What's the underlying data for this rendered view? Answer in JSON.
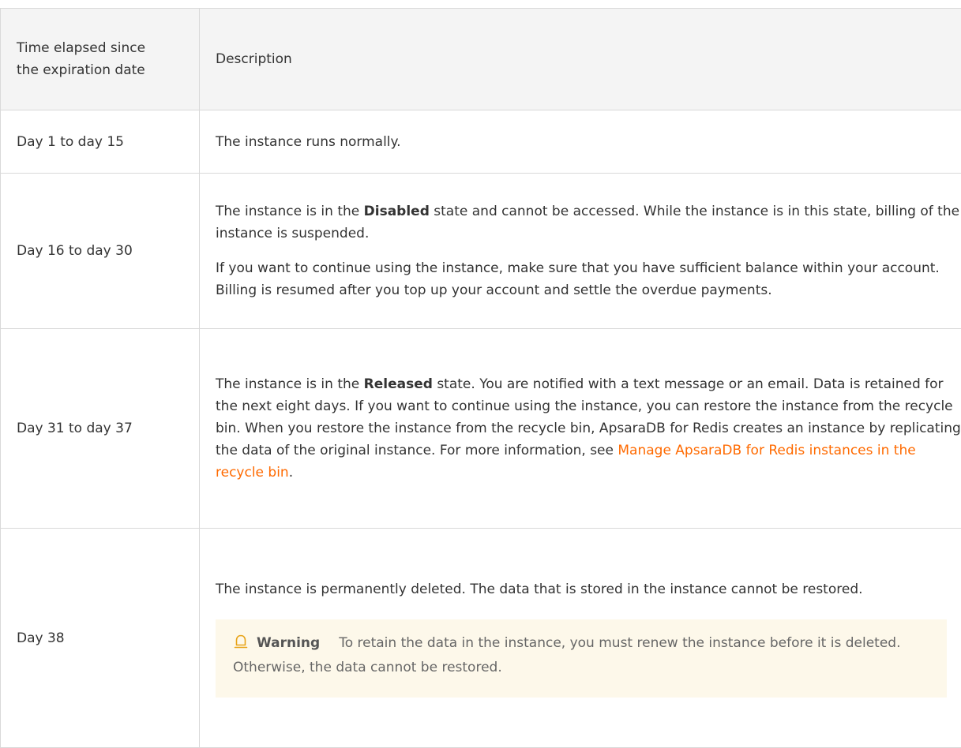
{
  "table": {
    "headers": {
      "time": "Time elapsed since the expiration date",
      "description": "Description"
    },
    "rows": [
      {
        "time": "Day 1 to day 15",
        "text": "The instance runs normally."
      },
      {
        "time": "Day 16 to day 30",
        "p1_before": "The instance is in the ",
        "p1_bold": "Disabled",
        "p1_after": " state and cannot be accessed. While the instance is in this state, billing of the instance is suspended.",
        "p2": "If you want to continue using the instance, make sure that you have sufficient balance within your account. Billing is resumed after you top up your account and settle the overdue payments."
      },
      {
        "time": "Day 31 to day 37",
        "p1_before": "The instance is in the ",
        "p1_bold": "Released",
        "p1_after": " state. You are notified with a text message or an email. Data is retained for the next eight days. If you want to continue using the instance, you can restore the instance from the recycle bin. When you restore the instance from the recycle bin, ApsaraDB for Redis creates an instance by replicating the data of the original instance. For more information, see ",
        "link": "Manage ApsaraDB for Redis instances in the recycle bin",
        "p1_end": "."
      },
      {
        "time": "Day 38",
        "text": "The instance is permanently deleted. The data that is stored in the instance cannot be restored.",
        "warning_title": "Warning",
        "warning_text": "To retain the data in the instance, you must renew the instance before it is deleted. Otherwise, the data cannot be restored."
      }
    ]
  },
  "colors": {
    "link": "#ff6a00",
    "warning_bg": "#fdf8ea",
    "warning_icon": "#e8a317",
    "header_bg": "#f4f4f4"
  },
  "icons": {
    "warning": "bell-icon"
  }
}
